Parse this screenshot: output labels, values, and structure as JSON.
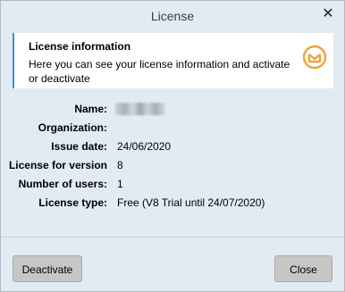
{
  "window": {
    "title": "License",
    "close_icon": "close-icon"
  },
  "info": {
    "title": "License information",
    "text": "Here you can see your license information and activate or deactivate",
    "icon": "license-envelope-icon",
    "icon_color": "#f0a23a"
  },
  "fields": [
    {
      "label": "Name:",
      "value": "",
      "blurred": true
    },
    {
      "label": "Organization:",
      "value": ""
    },
    {
      "label": "Issue date:",
      "value": "24/06/2020"
    },
    {
      "label": "License for version",
      "value": "8"
    },
    {
      "label": "Number of users:",
      "value": "1"
    },
    {
      "label": "License type:",
      "value": "Free (V8 Trial until 24/07/2020)"
    }
  ],
  "buttons": {
    "deactivate": "Deactivate",
    "close": "Close"
  },
  "colors": {
    "background": "#e2ebf4",
    "panel": "#ffffff",
    "accent": "#3c8fd6",
    "button": "#c6c6c6"
  }
}
